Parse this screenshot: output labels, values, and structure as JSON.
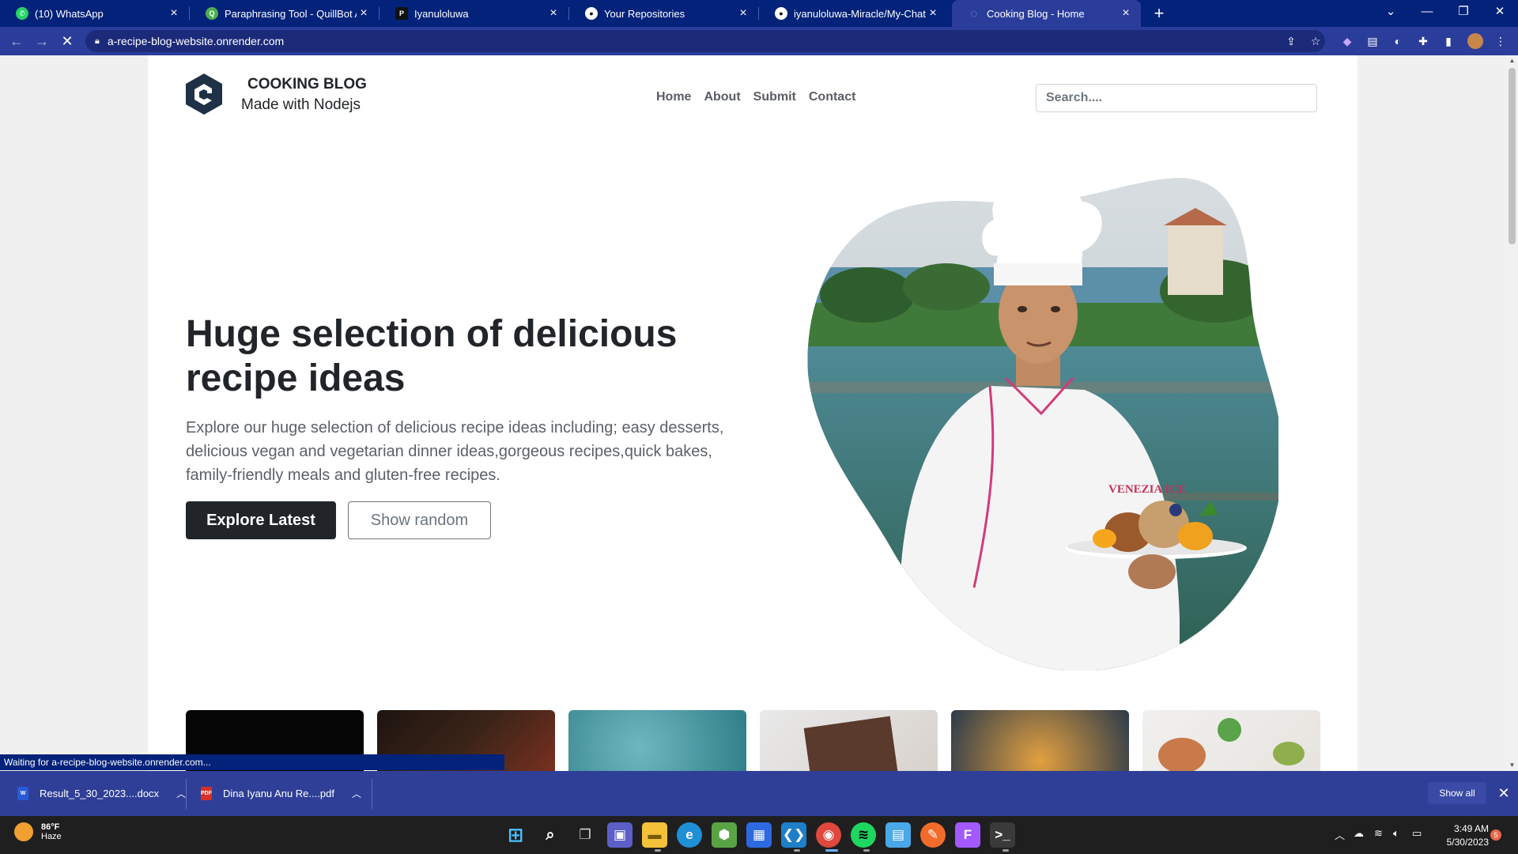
{
  "browser": {
    "tabs": [
      {
        "label": "(10) WhatsApp",
        "icon": "whatsapp-icon",
        "color": "#25d366",
        "glyph": "✆"
      },
      {
        "label": "Paraphrasing Tool - QuillBot AI",
        "icon": "quillbot-icon",
        "color": "#4caf50",
        "glyph": "Q"
      },
      {
        "label": "Iyanuloluwa",
        "icon": "profile-icon",
        "color": "#111111",
        "glyph": "P"
      },
      {
        "label": "Your Repositories",
        "icon": "github-icon",
        "color": "#ffffff",
        "glyph": "●"
      },
      {
        "label": "iyanuloluwa-Miracle/My-Chat-Ap",
        "icon": "github-icon",
        "color": "#ffffff",
        "glyph": "●"
      },
      {
        "label": "Cooking Blog - Home",
        "icon": "loading-icon",
        "color": "#8fa3ff",
        "glyph": "◌",
        "active": true
      }
    ],
    "url": "a-recipe-blog-website.onrender.com",
    "status_text": "Waiting for a-recipe-blog-website.onrender.com..."
  },
  "site": {
    "brand_title": "COOKING BLOG",
    "brand_subtitle": "Made with Nodejs",
    "nav": [
      "Home",
      "About",
      "Submit",
      "Contact"
    ],
    "search_placeholder": "Search....",
    "hero": {
      "title": "Huge selection of delicious recipe ideas",
      "text": "Explore our huge selection of delicious recipe ideas including; easy desserts, delicious vegan and vegetarian dinner ideas,gorgeous recipes,quick bakes, family-friendly meals and gluten-free recipes.",
      "primary_button": "Explore Latest",
      "secondary_button": "Show random",
      "chef_badge": "VENEZIA ICE"
    }
  },
  "downloads": {
    "items": [
      {
        "name": "Result_5_30_2023....docx",
        "type": "docx"
      },
      {
        "name": "Dina Iyanu Anu Re....pdf",
        "type": "pdf"
      }
    ],
    "show_all": "Show all"
  },
  "taskbar": {
    "weather_temp": "86°F",
    "weather_desc": "Haze",
    "time": "3:49 AM",
    "date": "5/30/2023",
    "notification_count": "5"
  },
  "colors": {
    "tab_bar": "#03227a",
    "toolbar": "#2b3d9a",
    "primary_button": "#212529",
    "shelf": "#2f3f98"
  }
}
